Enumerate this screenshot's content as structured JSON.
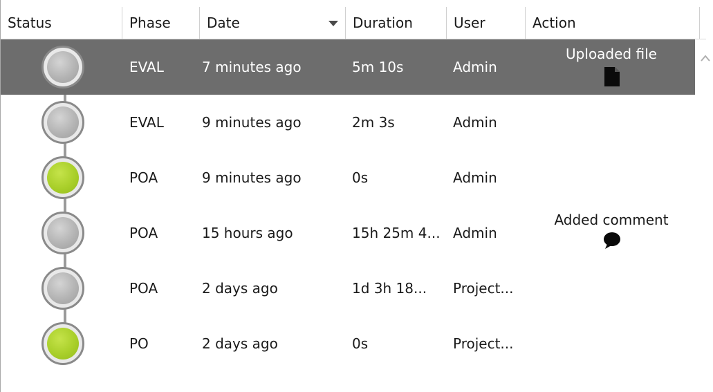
{
  "columns": {
    "status": "Status",
    "phase": "Phase",
    "date": "Date",
    "duration": "Duration",
    "user": "User",
    "action": "Action"
  },
  "rows": [
    {
      "status": "gray",
      "phase": "EVAL",
      "date": "7 minutes ago",
      "duration": "5m 10s",
      "user": "Admin",
      "action": "Uploaded file",
      "action_icon": "file-icon",
      "selected": true
    },
    {
      "status": "gray",
      "phase": "EVAL",
      "date": "9 minutes ago",
      "duration": "2m 3s",
      "user": "Admin",
      "action": "",
      "action_icon": "",
      "selected": false
    },
    {
      "status": "green",
      "phase": "POA",
      "date": "9 minutes ago",
      "duration": "0s",
      "user": "Admin",
      "action": "",
      "action_icon": "",
      "selected": false
    },
    {
      "status": "gray",
      "phase": "POA",
      "date": "15 hours ago",
      "duration": "15h 25m 4...",
      "user": "Admin",
      "action": "Added comment",
      "action_icon": "comment-icon",
      "selected": false
    },
    {
      "status": "gray",
      "phase": "POA",
      "date": "2 days ago",
      "duration": "1d 3h 18...",
      "user": "Project...",
      "action": "",
      "action_icon": "",
      "selected": false
    },
    {
      "status": "green",
      "phase": "PO",
      "date": "2 days ago",
      "duration": "0s",
      "user": "Project...",
      "action": "",
      "action_icon": "",
      "selected": false
    }
  ],
  "colors": {
    "selected_row": "#6d6d6d",
    "status_green": "#a9cf2a",
    "status_gray": "#b4b4b4"
  },
  "sort": {
    "column": "date",
    "direction": "descending"
  }
}
